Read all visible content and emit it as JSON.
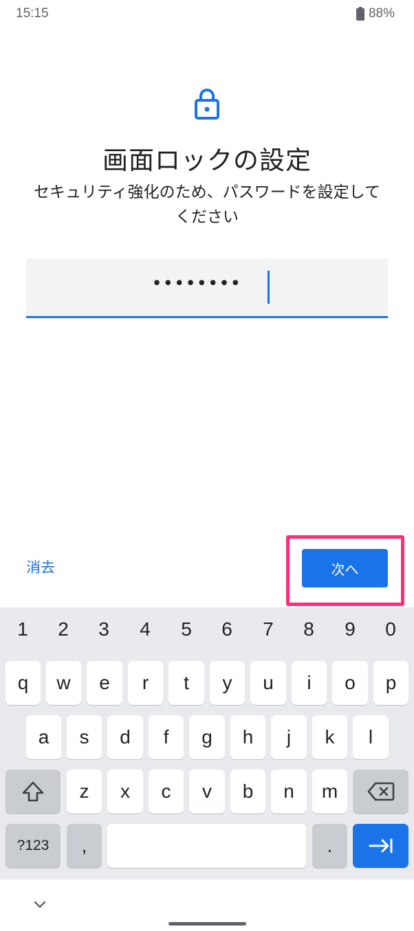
{
  "status_bar": {
    "time": "15:15",
    "battery": "88%"
  },
  "header": {
    "icon": "lock-icon",
    "title": "画面ロックの設定",
    "subtitle": "セキュリティ強化のため、パスワードを設定してください"
  },
  "password_field": {
    "value": "••••••••"
  },
  "actions": {
    "clear_label": "消去",
    "next_label": "次へ",
    "highlight_color": "#ff2d78"
  },
  "keyboard": {
    "number_row": [
      "1",
      "2",
      "3",
      "4",
      "5",
      "6",
      "7",
      "8",
      "9",
      "0"
    ],
    "row1": [
      "q",
      "w",
      "e",
      "r",
      "t",
      "y",
      "u",
      "i",
      "o",
      "p"
    ],
    "row2": [
      "a",
      "s",
      "d",
      "f",
      "g",
      "h",
      "j",
      "k",
      "l"
    ],
    "row3": [
      "z",
      "x",
      "c",
      "v",
      "b",
      "n",
      "m"
    ],
    "symbols_label": "?123",
    "comma": ",",
    "period": ".",
    "icons": {
      "shift": "shift-icon",
      "backspace": "backspace-icon",
      "enter": "tab-arrow-icon",
      "hide": "chevron-down-icon"
    }
  },
  "colors": {
    "accent": "#1a73e8",
    "keyboard_bg": "#e8eaed",
    "modifier_key": "#c9ccd1"
  }
}
